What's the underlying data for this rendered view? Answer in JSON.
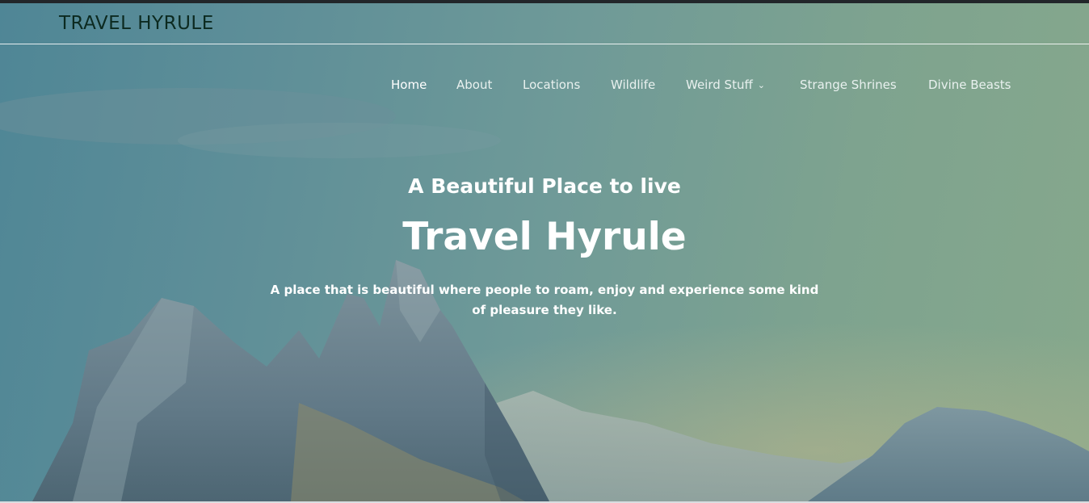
{
  "site": {
    "title": "TRAVEL HYRULE"
  },
  "nav": {
    "items": [
      {
        "label": "Home",
        "active": true
      },
      {
        "label": "About"
      },
      {
        "label": "Locations"
      },
      {
        "label": "Wildlife"
      },
      {
        "label": "Weird Stuff",
        "has_dropdown": true,
        "icon": "chevron-down-icon"
      },
      {
        "label": "Strange Shrines"
      },
      {
        "label": "Divine Beasts"
      }
    ]
  },
  "hero": {
    "subtitle": "A Beautiful Place to live",
    "title": "Travel Hyrule",
    "description": "A place that is beautiful where people to roam, enjoy and experience some kind of pleasure they like."
  },
  "colors": {
    "header_bar": "#22262a",
    "sky_left": "#4f8696",
    "sky_right": "#86a88c",
    "site_title": "#0c2a20",
    "text_light": "#ffffff"
  }
}
